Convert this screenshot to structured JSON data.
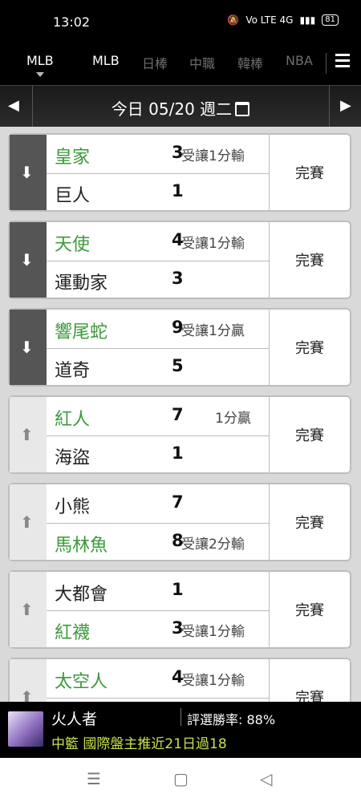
{
  "status_bar": {
    "time": "13:02",
    "network": "Vo LTE 4G",
    "battery": "81"
  },
  "tabs": [
    "MLB",
    "MLB",
    "日棒",
    "中職",
    "韓棒",
    "NBA"
  ],
  "date_bar": {
    "label": "今日 05/20 週二"
  },
  "games": [
    {
      "home": "皇家",
      "away": "巨人",
      "home_score": "3",
      "away_score": "1",
      "spread": "受讓1分輸",
      "spread_row": 1,
      "status": "完賽",
      "trend": "down",
      "winner_row": 1
    },
    {
      "home": "天使",
      "away": "運動家",
      "home_score": "4",
      "away_score": "3",
      "spread": "受讓1分輸",
      "spread_row": 1,
      "status": "完賽",
      "trend": "down",
      "winner_row": 1
    },
    {
      "home": "響尾蛇",
      "away": "道奇",
      "home_score": "9",
      "away_score": "5",
      "spread": "受讓1分贏",
      "spread_row": 1,
      "status": "完賽",
      "trend": "down",
      "winner_row": 1
    },
    {
      "home": "紅人",
      "away": "海盜",
      "home_score": "7",
      "away_score": "1",
      "spread": "1分贏",
      "spread_row": 1,
      "status": "完賽",
      "trend": "up",
      "winner_row": 1
    },
    {
      "home": "小熊",
      "away": "馬林魚",
      "home_score": "7",
      "away_score": "8",
      "spread": "受讓2分輸",
      "spread_row": 2,
      "status": "完賽",
      "trend": "up",
      "winner_row": 2
    },
    {
      "home": "大都會",
      "away": "紅襪",
      "home_score": "1",
      "away_score": "3",
      "spread": "受讓1分輸",
      "spread_row": 2,
      "status": "完賽",
      "trend": "up",
      "winner_row": 2
    },
    {
      "home": "太空人",
      "away": "",
      "home_score": "4",
      "away_score": "",
      "spread": "受讓1分輸",
      "spread_row": 1,
      "status": "完賽",
      "trend": "up",
      "winner_row": 1
    }
  ],
  "banner": {
    "name": "火人者",
    "rate": "評選勝率: 88%",
    "news": "中籃 國際盤主推近21日過18"
  },
  "icons": {
    "menu": "hamburger-icon",
    "prev": "left-arrow-icon",
    "next": "right-arrow-icon",
    "calendar": "calendar-icon"
  },
  "colors": {
    "green": "#3b9a3b",
    "news": "#c7e24a"
  }
}
